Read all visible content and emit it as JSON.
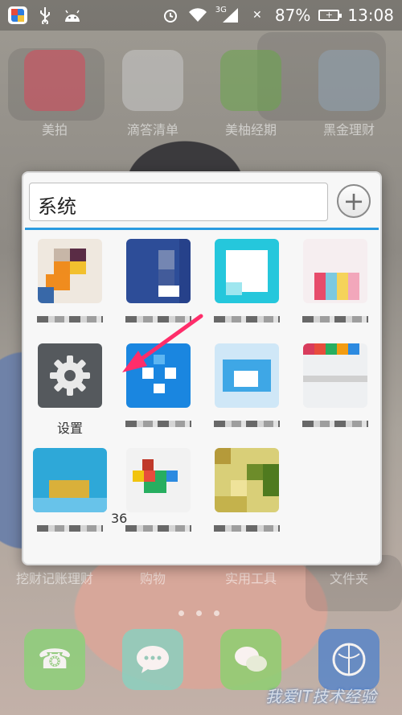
{
  "status_bar": {
    "network_label": "3G",
    "battery_percent": "87%",
    "time": "13:08",
    "left_icons": [
      "app-notification-icon",
      "usb-icon",
      "android-debug-icon"
    ],
    "right_icons": [
      "alarm-icon",
      "wifi-icon",
      "signal-icon",
      "no-sim-icon",
      "battery-icon"
    ]
  },
  "home_screen": {
    "row1_labels": [
      "美拍",
      "滴答清单",
      "美柚经期",
      "黑金理财"
    ],
    "row2_labels": [
      "挖财记账理财",
      "购物",
      "实用工具",
      "文件夹"
    ]
  },
  "folder": {
    "name": "系统",
    "add_button": "+",
    "apps": [
      {
        "label": ""
      },
      {
        "label": ""
      },
      {
        "label": ""
      },
      {
        "label": ""
      },
      {
        "label": "设置"
      },
      {
        "label": ""
      },
      {
        "label": ""
      },
      {
        "label": ""
      },
      {
        "label": ""
      },
      {
        "label": ""
      },
      {
        "label": ""
      }
    ],
    "partial_text": "36"
  },
  "dock": {
    "icons": [
      "phone-icon",
      "messages-icon",
      "wechat-icon",
      "browser-icon"
    ]
  },
  "watermark": "我爱IT技术经验",
  "colors": {
    "accent_divider": "#2a9be0",
    "arrow": "#ff2d6a",
    "settings_bg": "#55595d"
  }
}
